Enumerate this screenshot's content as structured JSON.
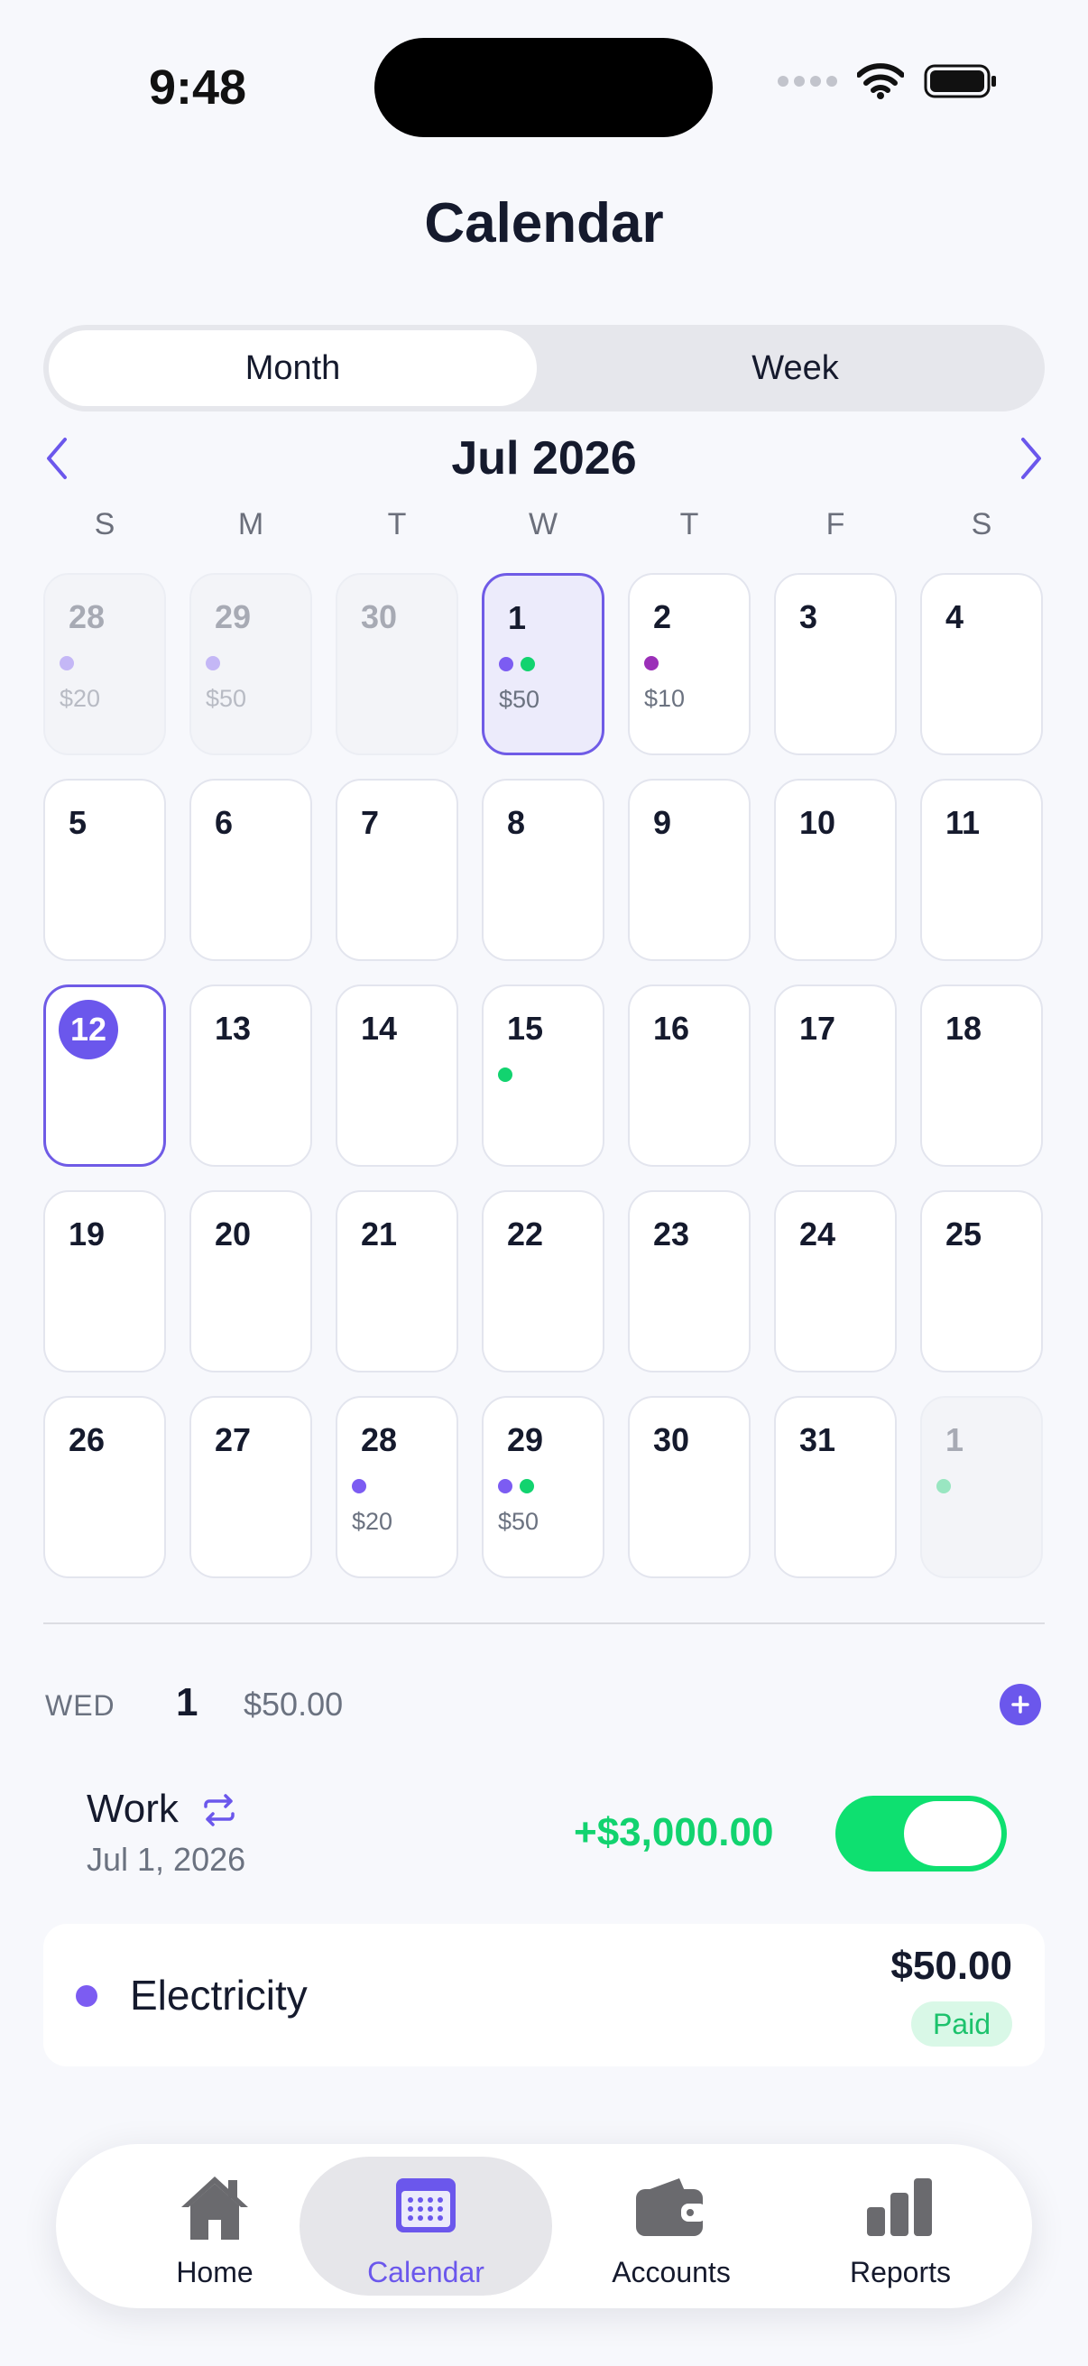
{
  "status": {
    "time": "9:48"
  },
  "header": {
    "title": "Calendar"
  },
  "segmented": {
    "month": "Month",
    "week": "Week",
    "selected": "Month"
  },
  "nav": {
    "month_label": "Jul 2026"
  },
  "weekdays": [
    "S",
    "M",
    "T",
    "W",
    "T",
    "F",
    "S"
  ],
  "colors": {
    "accent": "#6b57ec",
    "purple_dot": "#7c5cf2",
    "magenta_dot": "#9b2fb8",
    "green_dot": "#12d36f",
    "green_text": "#12d36f"
  },
  "calendar": {
    "weeks": [
      [
        {
          "num": "28",
          "state": "outside",
          "dots": [
            "purple"
          ],
          "amount": "$20"
        },
        {
          "num": "29",
          "state": "outside",
          "dots": [
            "purple"
          ],
          "amount": "$50"
        },
        {
          "num": "30",
          "state": "outside",
          "dots": [],
          "amount": ""
        },
        {
          "num": "1",
          "state": "selected",
          "dots": [
            "purple",
            "green"
          ],
          "amount": "$50"
        },
        {
          "num": "2",
          "state": "normal",
          "dots": [
            "magenta"
          ],
          "amount": "$10"
        },
        {
          "num": "3",
          "state": "normal",
          "dots": [],
          "amount": ""
        },
        {
          "num": "4",
          "state": "normal",
          "dots": [],
          "amount": ""
        }
      ],
      [
        {
          "num": "5",
          "state": "normal",
          "dots": [],
          "amount": ""
        },
        {
          "num": "6",
          "state": "normal",
          "dots": [],
          "amount": ""
        },
        {
          "num": "7",
          "state": "normal",
          "dots": [],
          "amount": ""
        },
        {
          "num": "8",
          "state": "normal",
          "dots": [],
          "amount": ""
        },
        {
          "num": "9",
          "state": "normal",
          "dots": [],
          "amount": ""
        },
        {
          "num": "10",
          "state": "normal",
          "dots": [],
          "amount": ""
        },
        {
          "num": "11",
          "state": "normal",
          "dots": [],
          "amount": ""
        }
      ],
      [
        {
          "num": "12",
          "state": "today",
          "dots": [],
          "amount": ""
        },
        {
          "num": "13",
          "state": "normal",
          "dots": [],
          "amount": ""
        },
        {
          "num": "14",
          "state": "normal",
          "dots": [],
          "amount": ""
        },
        {
          "num": "15",
          "state": "normal",
          "dots": [
            "green"
          ],
          "amount": ""
        },
        {
          "num": "16",
          "state": "normal",
          "dots": [],
          "amount": ""
        },
        {
          "num": "17",
          "state": "normal",
          "dots": [],
          "amount": ""
        },
        {
          "num": "18",
          "state": "normal",
          "dots": [],
          "amount": ""
        }
      ],
      [
        {
          "num": "19",
          "state": "normal",
          "dots": [],
          "amount": ""
        },
        {
          "num": "20",
          "state": "normal",
          "dots": [],
          "amount": ""
        },
        {
          "num": "21",
          "state": "normal",
          "dots": [],
          "amount": ""
        },
        {
          "num": "22",
          "state": "normal",
          "dots": [],
          "amount": ""
        },
        {
          "num": "23",
          "state": "normal",
          "dots": [],
          "amount": ""
        },
        {
          "num": "24",
          "state": "normal",
          "dots": [],
          "amount": ""
        },
        {
          "num": "25",
          "state": "normal",
          "dots": [],
          "amount": ""
        }
      ],
      [
        {
          "num": "26",
          "state": "normal",
          "dots": [],
          "amount": ""
        },
        {
          "num": "27",
          "state": "normal",
          "dots": [],
          "amount": ""
        },
        {
          "num": "28",
          "state": "normal",
          "dots": [
            "purple"
          ],
          "amount": "$20"
        },
        {
          "num": "29",
          "state": "normal",
          "dots": [
            "purple",
            "green"
          ],
          "amount": "$50"
        },
        {
          "num": "30",
          "state": "normal",
          "dots": [],
          "amount": ""
        },
        {
          "num": "31",
          "state": "normal",
          "dots": [],
          "amount": ""
        },
        {
          "num": "1",
          "state": "outside",
          "dots": [
            "green"
          ],
          "amount": ""
        }
      ]
    ]
  },
  "day": {
    "weekday": "WED",
    "number": "1",
    "total": "$50.00"
  },
  "income": {
    "name": "Work",
    "date": "Jul 1, 2026",
    "amount": "+$3,000.00",
    "toggle_on": true
  },
  "bill": {
    "name": "Electricity",
    "amount": "$50.00",
    "status": "Paid"
  },
  "tabs": [
    {
      "label": "Home",
      "icon": "home-icon"
    },
    {
      "label": "Calendar",
      "icon": "calendar-icon",
      "active": true
    },
    {
      "label": "Accounts",
      "icon": "wallet-icon"
    },
    {
      "label": "Reports",
      "icon": "bar-chart-icon"
    }
  ]
}
